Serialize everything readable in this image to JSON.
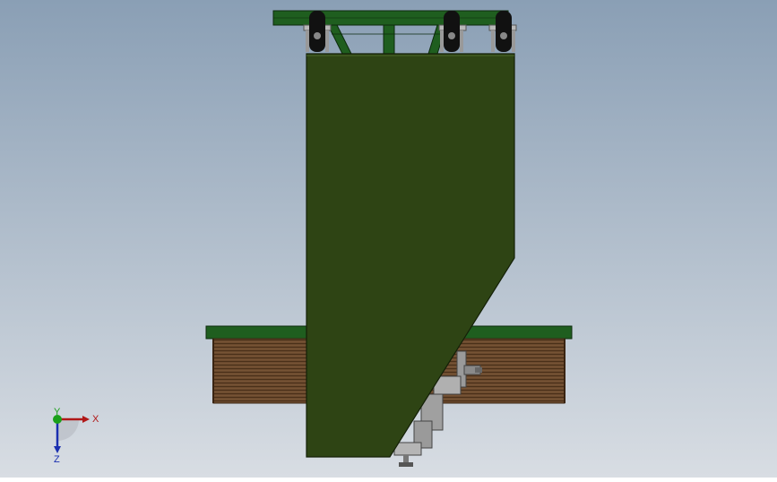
{
  "viewport": {
    "background_top": "#8a9fb5",
    "background_bottom": "#d8dde3",
    "part_green": "#2e4414",
    "frame_green": "#1d5a1d",
    "wood_brown": "#6b4a2e",
    "wheel_black": "#111111",
    "metal_grey": "#a9a9a9"
  },
  "triad": {
    "x_label": "X",
    "y_label": "Y",
    "z_label": "Z",
    "x_color": "#b01818",
    "y_color": "#1aa01a",
    "z_color": "#1a2fb0"
  }
}
